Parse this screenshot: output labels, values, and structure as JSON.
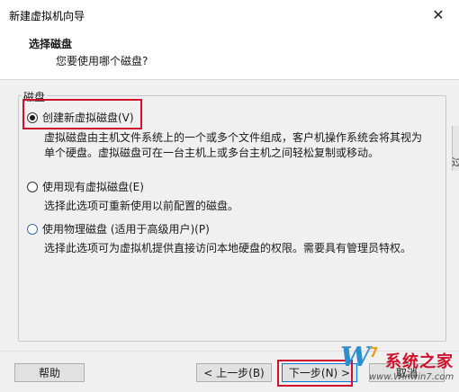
{
  "window": {
    "title": "新建虚拟机向导",
    "close_glyph": "✕"
  },
  "header": {
    "title": "选择磁盘",
    "subtitle": "您要使用哪个磁盘?"
  },
  "group": {
    "label": "磁盘"
  },
  "options": [
    {
      "label": "创建新虚拟磁盘(V)",
      "selected": true,
      "desc_line1": "虚拟磁盘由主机文件系统上的一个或多个文件组成，客户机操作系统会将其视为",
      "desc_line2": "单个硬盘。虚拟磁盘可在一台主机上或多台主机之间轻松复制或移动。"
    },
    {
      "label": "使用现有虚拟磁盘(E)",
      "selected": false,
      "desc_line1": "选择此选项可重新使用以前配置的磁盘。"
    },
    {
      "label": "使用物理磁盘 (适用于高级用户)(P)",
      "selected": false,
      "desc_line1": "选择此选项可为虚拟机提供直接访问本地硬盘的权限。需要具有管理员特权。"
    }
  ],
  "edge_text": "过",
  "buttons": {
    "help": "帮助",
    "back": "< 上一步(B)",
    "next": "下一步(N) >",
    "cancel": "取消"
  },
  "watermark": {
    "logo_letter": "W",
    "logo_digit": "7",
    "brand": "系统之家",
    "url": "www.Winwin7.com"
  },
  "colors": {
    "highlight": "#d0102c",
    "accent": "#2a8fd0"
  }
}
